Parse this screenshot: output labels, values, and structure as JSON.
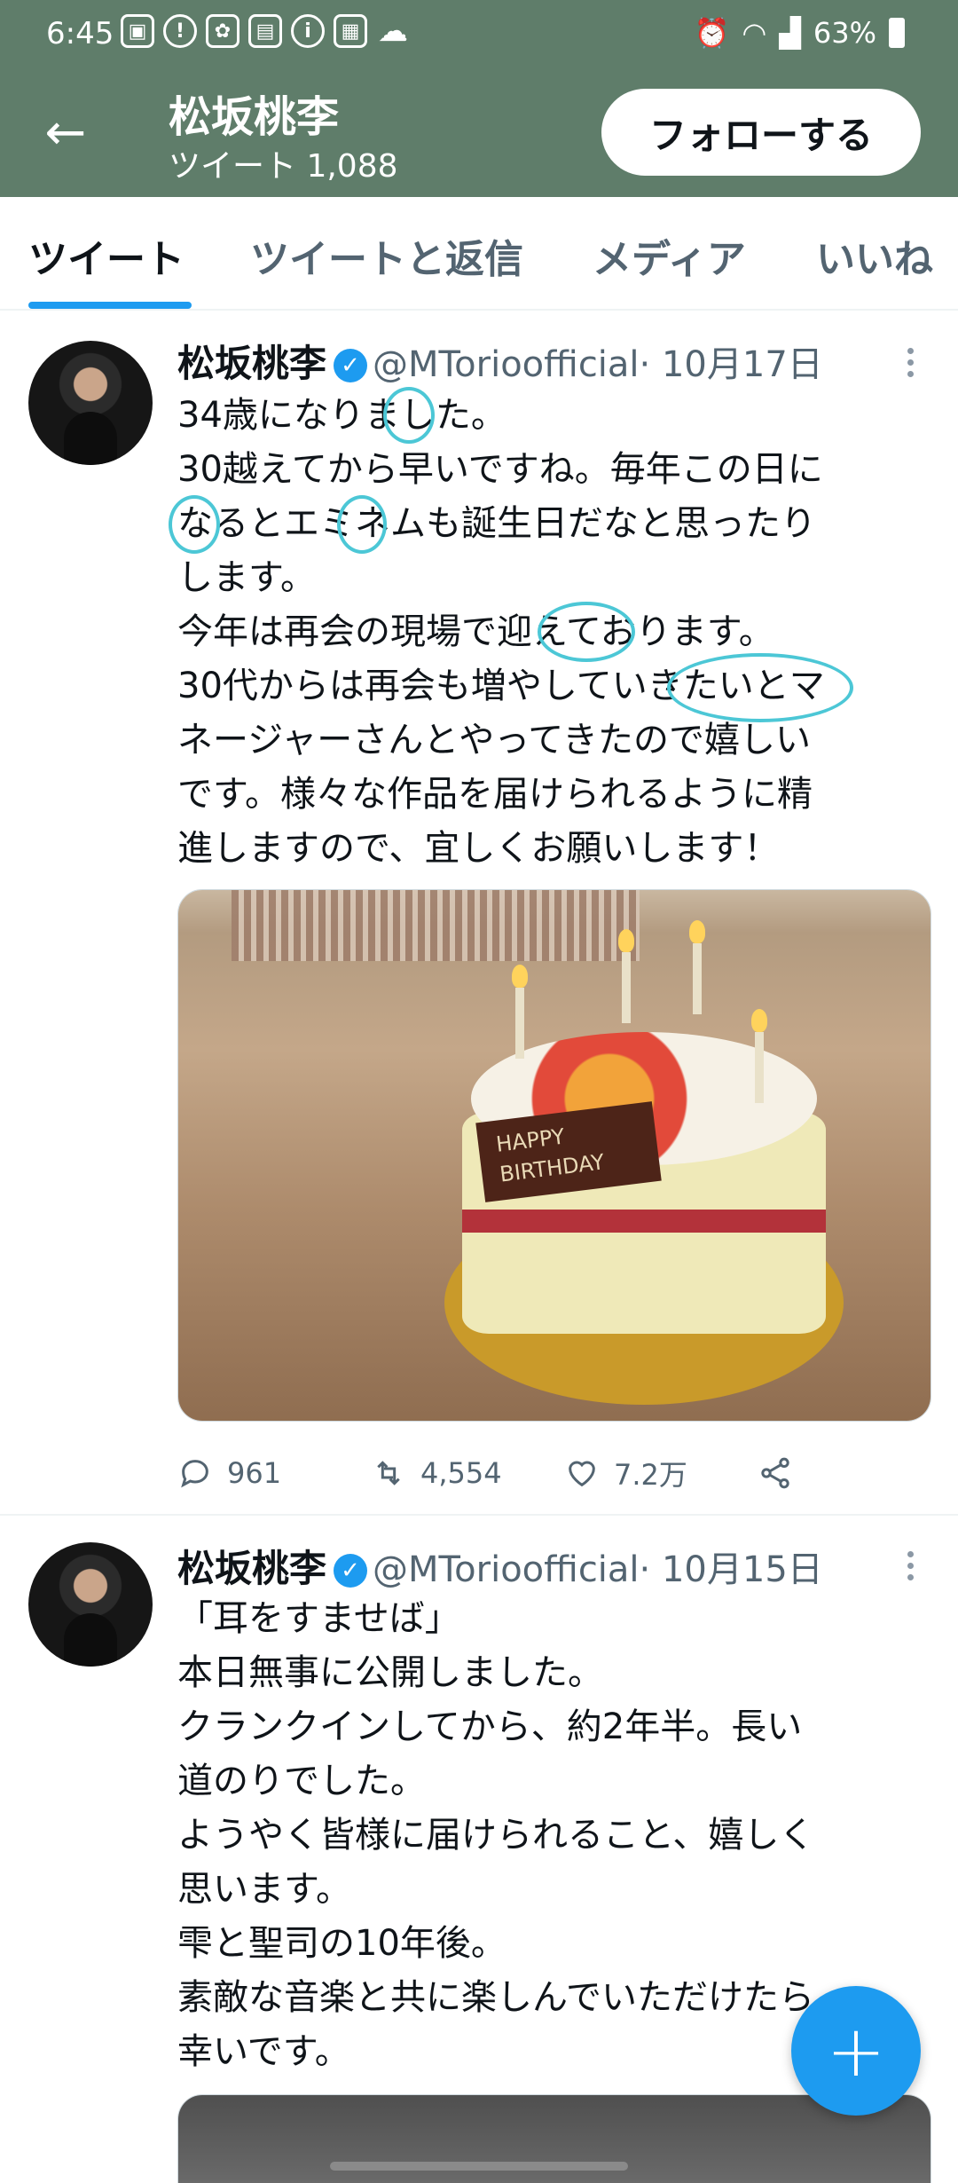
{
  "status_bar": {
    "time": "6:45",
    "battery": "63%",
    "icons": [
      "screenshot-icon",
      "shield-icon",
      "app-icon",
      "sim-icon",
      "info-icon",
      "calendar-icon",
      "cloud-icon",
      "alarm-icon",
      "wifi-icon",
      "signal-icon",
      "battery-icon"
    ]
  },
  "header": {
    "name": "松坂桃李",
    "tweet_count": "ツイート 1,088",
    "follow_label": "フォローする",
    "accent": "#5f7d6a"
  },
  "tabs": [
    {
      "label": "ツイート"
    },
    {
      "label": "ツイートと返信"
    },
    {
      "label": "メディア"
    },
    {
      "label": "いいね"
    }
  ],
  "tweets": [
    {
      "name": "松坂桃李",
      "handle": "@MTorioofficial",
      "date": "· 10月17日",
      "lines": [
        "34歳になりました。",
        "30越えてから早いですね。毎年この日に",
        "なるとエミネムも誕生日だなと思ったり",
        "します。",
        "今年は再会の現場で迎えております。",
        "30代からは再会も増やしていきたいとマ",
        "ネージャーさんとやってきたので嬉しい",
        "です。様々な作品を届けられるように精",
        "進しますので、宜しくお願いします！"
      ],
      "image_text": "HAPPY BIRTHDAY",
      "replies": "961",
      "retweets": "4,554",
      "likes": "7.2万"
    },
    {
      "name": "松坂桃李",
      "handle": "@MTorioofficial",
      "date": "· 10月15日",
      "lines": [
        "「耳をすませば」",
        "本日無事に公開しました。",
        "クランクインしてから、約2年半。長い",
        "道のりでした。",
        "ようやく皆様に届けられること、嬉しく",
        "思います。",
        "雫と聖司の10年後。",
        "素敵な音楽と共に楽しんでいただけたら",
        "幸いです。"
      ]
    }
  ],
  "fab": {
    "icon": "plus-icon",
    "color": "#1d9bf0"
  }
}
